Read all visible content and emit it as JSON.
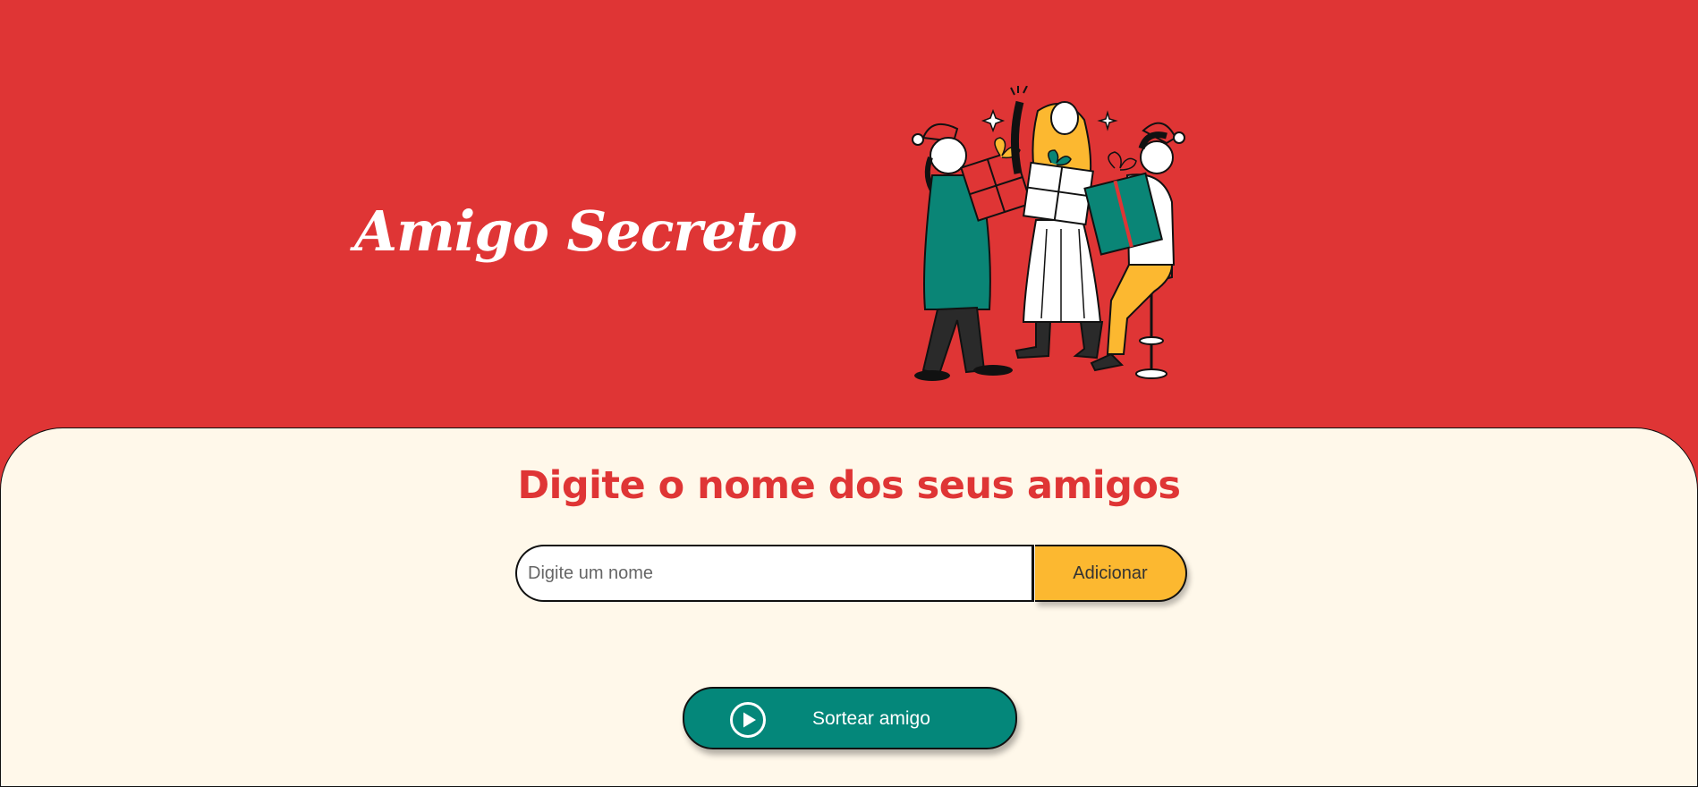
{
  "header": {
    "title": "Amigo Secreto",
    "illustration": "friends-exchanging-gifts-illustration"
  },
  "main": {
    "subtitle": "Digite o nome dos seus amigos",
    "input": {
      "placeholder": "Digite um nome",
      "value": ""
    },
    "add_button_label": "Adicionar",
    "draw_button_label": "Sortear amigo",
    "draw_button_icon": "play-circle-icon"
  },
  "colors": {
    "header_bg": "#df3535",
    "panel_bg": "#fff8ea",
    "accent_red": "#df3535",
    "add_button": "#fcb830",
    "draw_button": "#04877a"
  }
}
